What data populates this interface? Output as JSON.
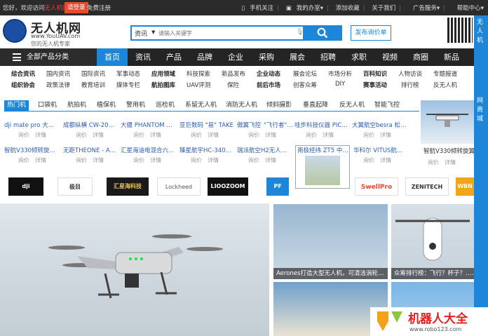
{
  "topbar": {
    "welcome": "您好，欢迎访问",
    "site_name": "无人机网!",
    "login": "请登录",
    "register": "免费注册",
    "links": [
      "手机关注",
      "我的办室",
      "添加收藏",
      "关于我们",
      "广告服务",
      "帮助中心"
    ]
  },
  "logo": {
    "title": "无人机网",
    "url": "www.YouUAV.com",
    "slogan": "您的无人机专家"
  },
  "search": {
    "category": "资讯",
    "placeholder": "请输入关键字",
    "post_button": "发布询价单"
  },
  "side_strip": [
    "无",
    "人",
    "机",
    "网",
    "商",
    "城"
  ],
  "nav": {
    "all_categories": "全部产品分类",
    "items": [
      "首页",
      "资讯",
      "产品",
      "品牌",
      "企业",
      "采购",
      "展会",
      "招聘",
      "求职",
      "视频",
      "商圈",
      "新品"
    ]
  },
  "sublinks": {
    "row1": [
      "综合资讯",
      "国内资讯",
      "国际资讯",
      "军事动态",
      "应用领域",
      "科技探索",
      "新品发布",
      "企业动态",
      "展会论坛",
      "市场分析",
      "百科知识",
      "人物访谈",
      "专题报道"
    ],
    "row2": [
      "组织协会",
      "政策法律",
      "教育培训",
      "媒体专栏",
      "航拍图库",
      "UAV评测",
      "保险",
      "前后市场",
      "创客众筹",
      "DIY",
      "赛事活动",
      "排行榜",
      "反无人机"
    ]
  },
  "tabs": [
    "热门机",
    "口袋机",
    "航拍机",
    "植保机",
    "警用机",
    "巡检机",
    "系留无人机",
    "消防无人机",
    "倾斜摄影",
    "垂直起降",
    "反无人机",
    "智能飞控"
  ],
  "product_actions": {
    "inquiry": "询价",
    "detail": "详情"
  },
  "products_row1": [
    "dji mate pro 大疆…",
    "成都纵横 CW-20大疆…",
    "大疆 PHANTOM 4…",
    "亚巨数码 \"易\" TAKE",
    "傲翼飞控",
    "\"飞行者\"…",
    "哇步科技仪器 PICA…",
    "大翼航空besra 松鼠…"
  ],
  "products_row2": [
    "智航V330倾转旋翼…",
    "无距THEONE - AH…",
    "汇星海油电混合六旋…",
    "臻星航宇HC-340六…",
    "瑞派航空H2无人机…",
    "南极经纬 ZT5 中型…",
    "华科尔 VITUS航拍…"
  ],
  "right_promo": {
    "title": "智航V330倾转旋翼无人机"
  },
  "brands": [
    "dji",
    "极目",
    "汇星海科技",
    "Lockheed",
    "LIOOZOOM",
    "PF",
    "SwellPro",
    "ZENITECH",
    "WBN"
  ],
  "colors": {
    "accent": "#1e86d8",
    "topbar": "#2b2b2b",
    "nav": "#242424",
    "red": "#e8492f"
  },
  "captions": {
    "img1": "Aerones打造大型无人机，可清洁涡轮…",
    "img2": "众筹排行榜：飞行？杯子？……",
    "img3": "",
    "img4": ""
  },
  "robot_logo": {
    "name": "机器人大全",
    "url": "www.robo123.com"
  }
}
